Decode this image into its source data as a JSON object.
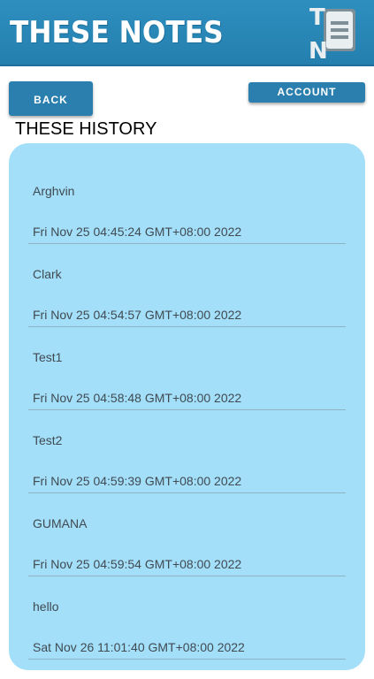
{
  "header": {
    "title": "These Notes",
    "logo_letters": [
      "T",
      "N"
    ],
    "logo_icon": "notebook-icon"
  },
  "nav": {
    "back_label": "BACK",
    "account_label": "ACCOUNT"
  },
  "page": {
    "title": "THESE HISTORY"
  },
  "history": [
    {
      "name": "Arghvin",
      "date": "Fri Nov 25 04:45:24 GMT+08:00 2022"
    },
    {
      "name": "Clark",
      "date": "Fri Nov 25 04:54:57 GMT+08:00 2022"
    },
    {
      "name": "Test1",
      "date": "Fri Nov 25 04:58:48 GMT+08:00 2022"
    },
    {
      "name": "Test2",
      "date": "Fri Nov 25 04:59:39 GMT+08:00 2022"
    },
    {
      "name": "GUMANA",
      "date": "Fri Nov 25 04:59:54 GMT+08:00 2022"
    },
    {
      "name": "hello",
      "date": "Sat Nov 26 11:01:40 GMT+08:00 2022"
    }
  ],
  "colors": {
    "header": "#2e8fbf",
    "button": "#2a7fae",
    "panel": "#a3dff8"
  }
}
